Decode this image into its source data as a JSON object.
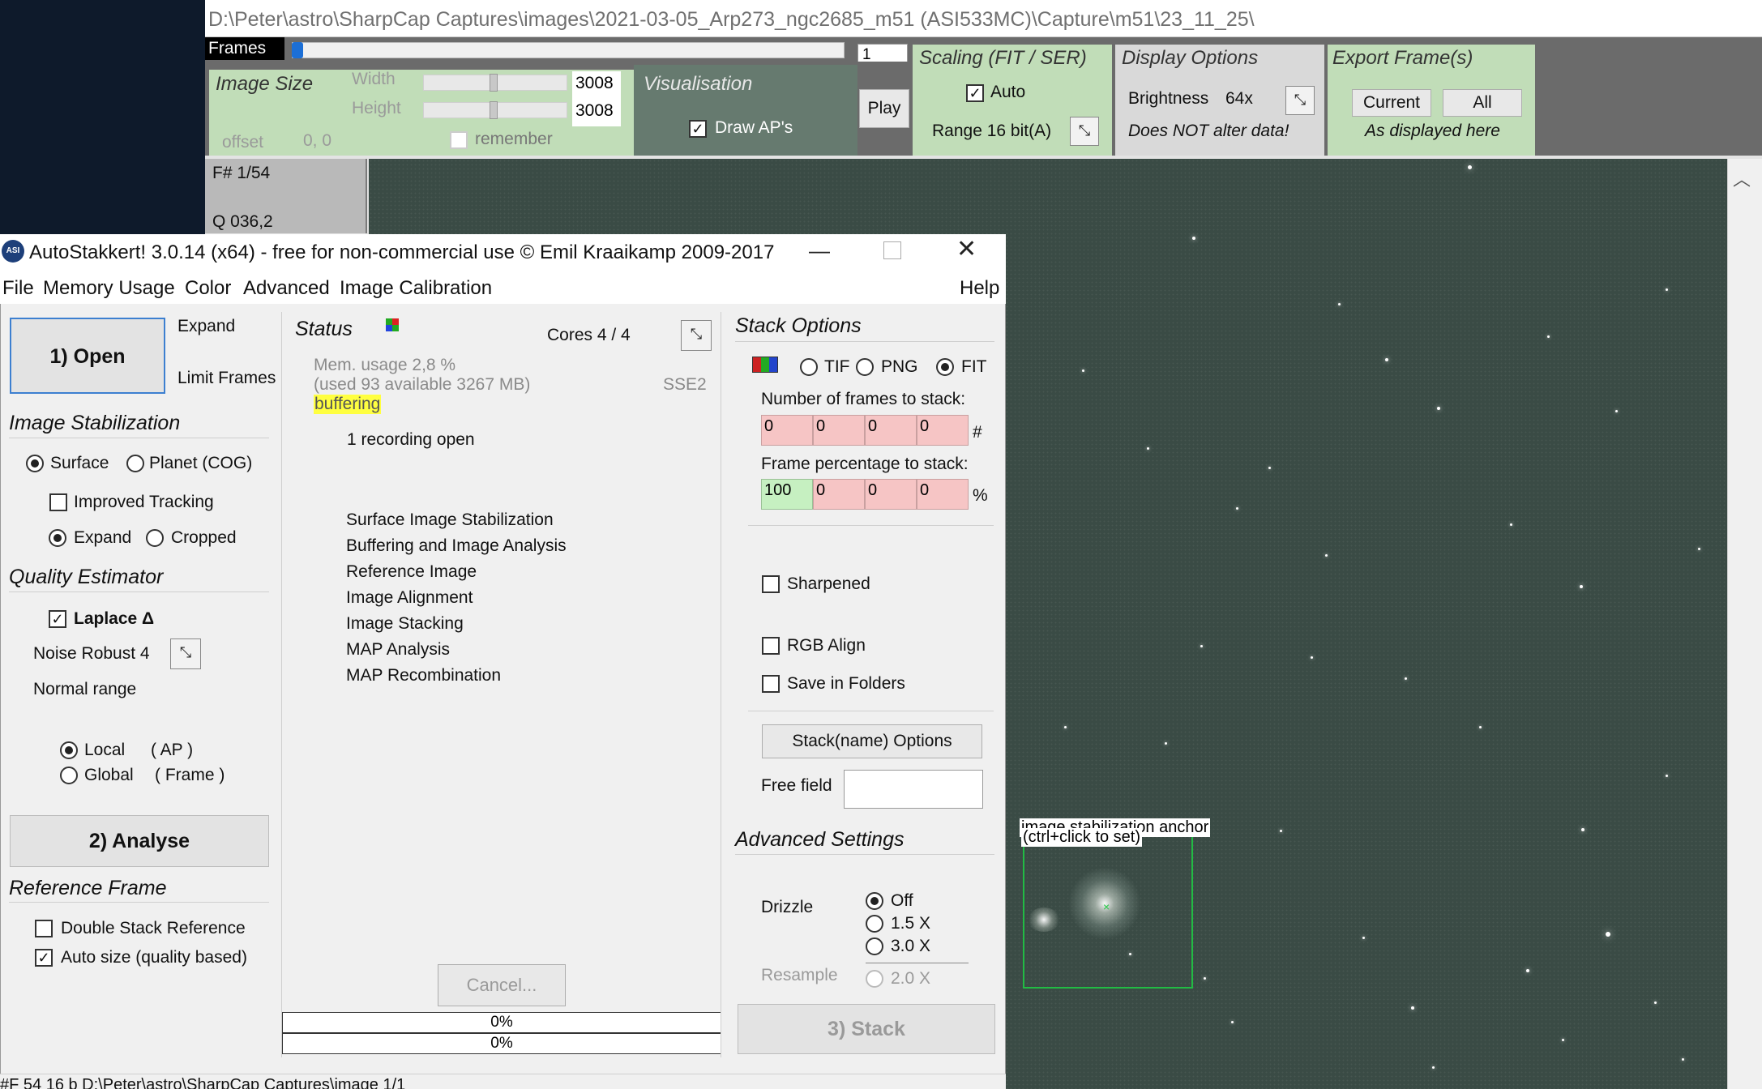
{
  "image_window": {
    "path": "D:\\Peter\\astro\\SharpCap Captures\\images\\2021-03-05_Arp273_ngc2685_m51 (ASI533MC)\\Capture\\m51\\23_11_25\\",
    "frames_label": "Frames",
    "frame_value": "1",
    "image_size": {
      "title": "Image Size",
      "width_label": "Width",
      "height_label": "Height",
      "width_value": "3008",
      "height_value": "3008",
      "offset_label": "offset",
      "offset_value": "0, 0",
      "remember_label": "remember"
    },
    "visualisation": {
      "title": "Visualisation",
      "draw_aps_label": "Draw AP's"
    },
    "play_label": "Play",
    "scaling": {
      "title": "Scaling (FIT / SER)",
      "auto_label": "Auto",
      "range_label": "Range 16 bit(A)"
    },
    "display_options": {
      "title": "Display Options",
      "brightness_label": "Brightness",
      "brightness_value": "64x",
      "note": "Does NOT alter data!"
    },
    "export": {
      "title": "Export Frame(s)",
      "current_label": "Current",
      "all_label": "All",
      "note": "As displayed here"
    },
    "frame_info": {
      "frame": "F# 1/54",
      "quality": "Q  036,2"
    },
    "anchor_label_1": "image stabilization anchor",
    "anchor_label_2": "(ctrl+click to set)",
    "scroll_up_icon": "chevron-up-icon"
  },
  "autostakkert": {
    "title": "AutoStakkert! 3.0.14 (x64) - free for non-commercial use © Emil Kraaikamp 2009-2017",
    "app_icon": "ASI",
    "menu": [
      "File",
      "Memory Usage",
      "Color",
      "Advanced",
      "Image Calibration"
    ],
    "help": "Help",
    "open_button": "1) Open",
    "expand_label": "Expand",
    "limit_frames_label": "Limit Frames",
    "image_stabilization": {
      "title": "Image Stabilization",
      "surface": "Surface",
      "planet": "Planet (COG)",
      "improved_tracking": "Improved Tracking",
      "expand": "Expand",
      "cropped": "Cropped"
    },
    "quality_estimator": {
      "title": "Quality Estimator",
      "laplace": "Laplace Δ",
      "noise_robust": "Noise Robust 4",
      "normal_range": "Normal range",
      "local": "Local",
      "local_ap": "( AP )",
      "global": "Global",
      "global_frame": "( Frame )"
    },
    "analyse_button": "2) Analyse",
    "reference_frame": {
      "title": "Reference Frame",
      "double_stack": "Double Stack Reference",
      "auto_size": "Auto size (quality based)"
    },
    "status": {
      "title": "Status",
      "cores": "Cores 4 / 4",
      "mem_usage": "Mem. usage 2,8 %",
      "mem_detail": "(used 93 available 3267 MB)",
      "sse": "SSE2",
      "buffering": "buffering",
      "recording": "1 recording open",
      "steps": [
        "Surface Image Stabilization",
        "Buffering and Image Analysis",
        "Reference Image",
        "Image Alignment",
        "Image Stacking",
        "MAP Analysis",
        "MAP Recombination"
      ],
      "cancel_button": "Cancel...",
      "progress1": "0%",
      "progress2": "0%"
    },
    "stack_options": {
      "title": "Stack Options",
      "tif": "TIF",
      "png": "PNG",
      "fit": "FIT",
      "frames_label": "Number of frames to stack:",
      "frames_values": [
        "0",
        "0",
        "0",
        "0"
      ],
      "frames_unit": "#",
      "percent_label": "Frame percentage to stack:",
      "percent_values": [
        "100",
        "0",
        "0",
        "0"
      ],
      "percent_unit": "%",
      "sharpened": "Sharpened",
      "rgb_align": "RGB Align",
      "save_in_folders": "Save in Folders",
      "stackname_button": "Stack(name) Options",
      "free_field_label": "Free field",
      "free_field_value": ""
    },
    "advanced_settings": {
      "title": "Advanced Settings",
      "drizzle_label": "Drizzle",
      "off": "Off",
      "x15": "1.5 X",
      "x30": "3.0 X",
      "resample_label": "Resample",
      "x20": "2.0 X"
    },
    "stack_button": "3) Stack",
    "statusbar": "#F 54    16 b D:\\Peter\\astro\\SharpCap Captures\\image 1/1"
  },
  "colors": {
    "green_panel": "#c1ddb8",
    "buffering_highlight": "#ffff40",
    "pink_field": "#f6c5c5",
    "green_field": "#c6f0c1",
    "anchor_box": "#22bb44"
  }
}
